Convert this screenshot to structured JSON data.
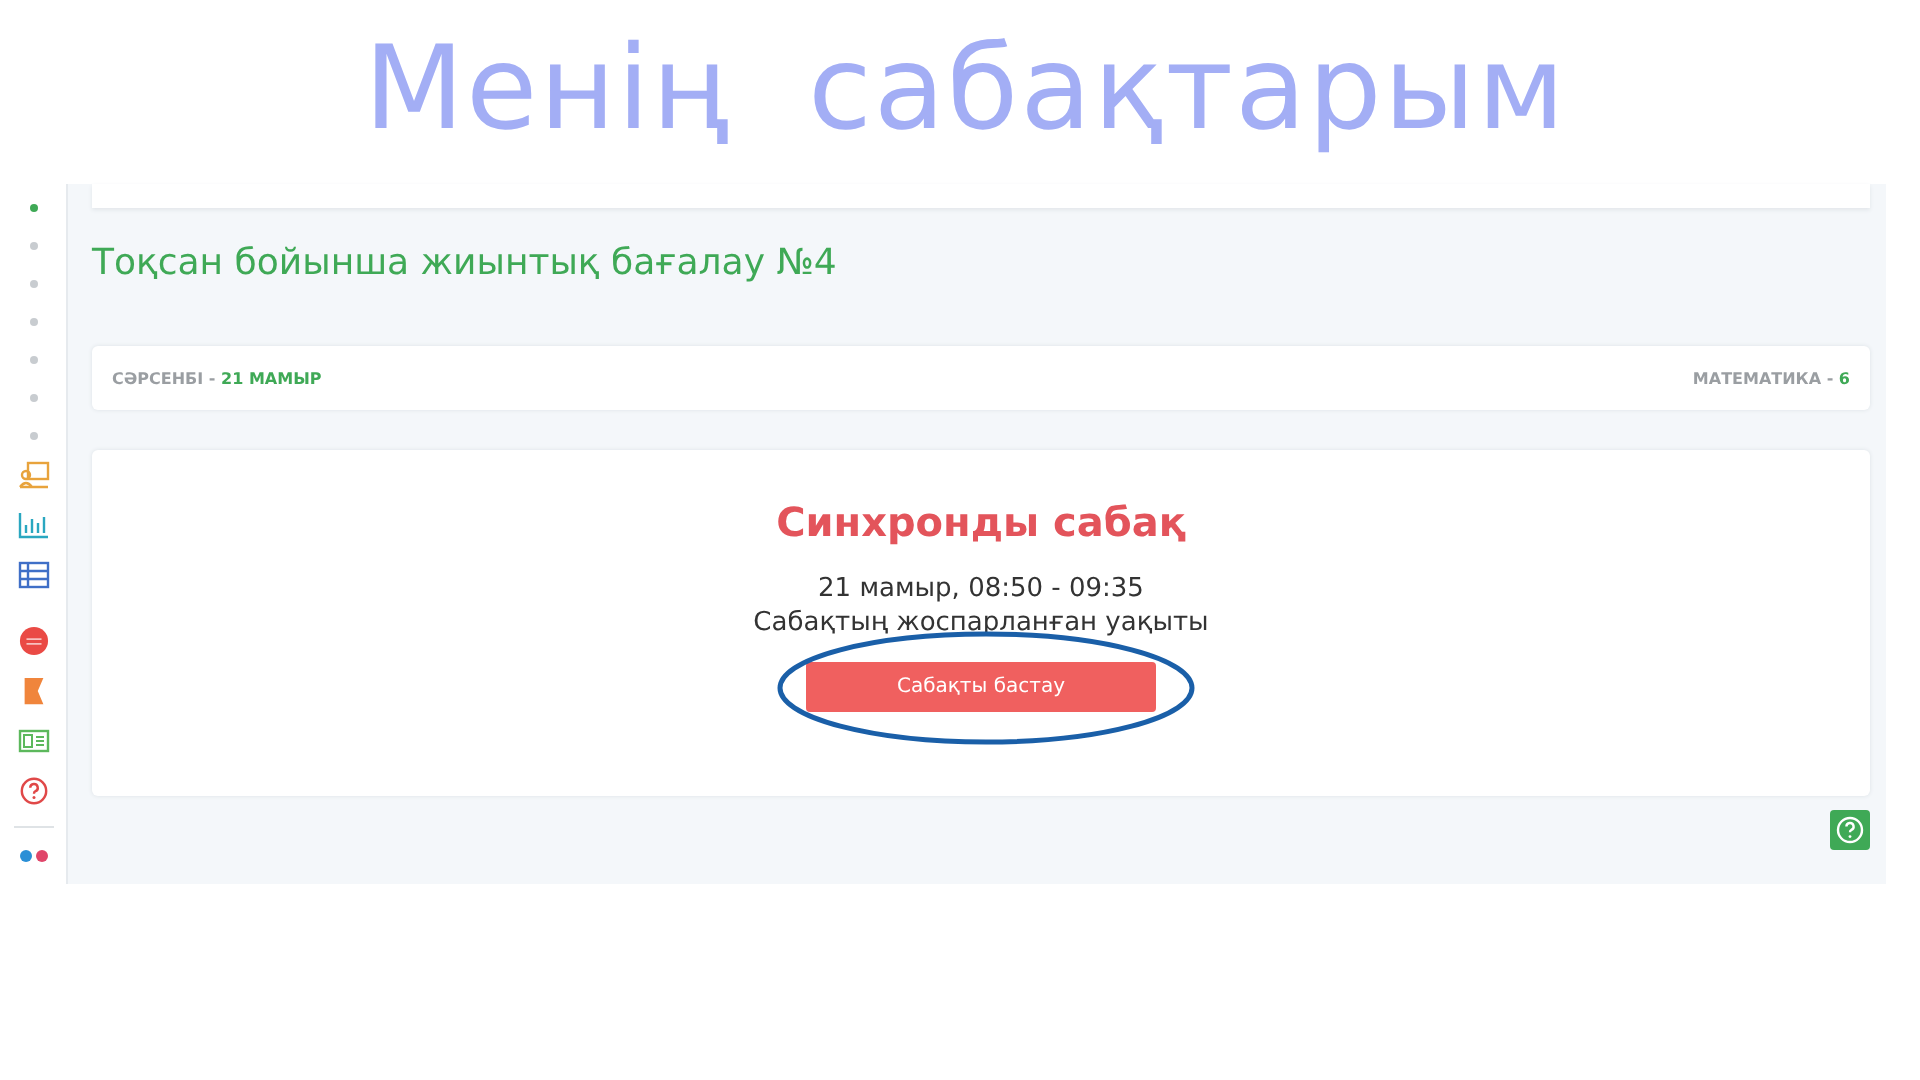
{
  "slide_title": "Менің  сабақтарым",
  "sidebar": {
    "dots": [
      {
        "selected": true
      },
      {
        "selected": false
      },
      {
        "selected": false
      },
      {
        "selected": false
      },
      {
        "selected": false
      },
      {
        "selected": false
      },
      {
        "selected": false
      }
    ]
  },
  "page_title": "Тоқсан бойынша жиынтық бағалау №4",
  "info_bar": {
    "day": "СӘРСЕНБІ -",
    "date": "21 МАМЫР",
    "subject": "МАТЕМАТИКА -",
    "grade": "6"
  },
  "lesson": {
    "heading": "Синхронды сабақ",
    "time": "21 мамыр, 08:50 - 09:35",
    "caption": "Сабақтың жоспарланған уақыты",
    "button": "Сабақты бастау",
    "highlighted": true
  }
}
